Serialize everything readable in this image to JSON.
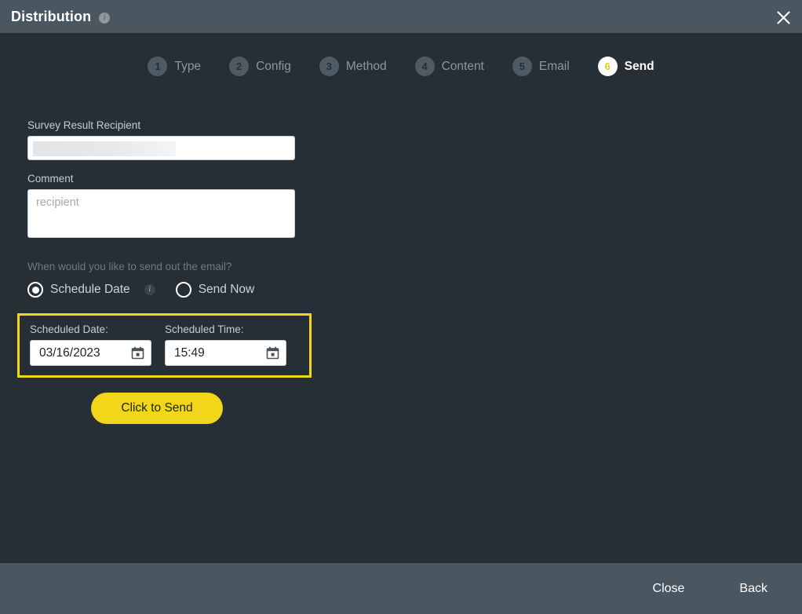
{
  "window": {
    "title": "Distribution",
    "title_info_icon": "info-icon",
    "close_icon": "close-icon"
  },
  "steps": [
    {
      "number": "1",
      "label": "Type",
      "active": false
    },
    {
      "number": "2",
      "label": "Config",
      "active": false
    },
    {
      "number": "3",
      "label": "Method",
      "active": false
    },
    {
      "number": "4",
      "label": "Content",
      "active": false
    },
    {
      "number": "5",
      "label": "Email",
      "active": false
    },
    {
      "number": "6",
      "label": "Send",
      "active": true
    }
  ],
  "form": {
    "recipient": {
      "label": "Survey Result Recipient",
      "value": "",
      "redacted": true
    },
    "comment": {
      "label": "Comment",
      "placeholder": "recipient",
      "value": ""
    },
    "when_question": "When would you like to send out the email?",
    "radios": [
      {
        "label": "Schedule Date",
        "selected": true,
        "info_icon": "info-icon"
      },
      {
        "label": "Send Now",
        "selected": false,
        "info_icon": null
      }
    ],
    "schedule": {
      "date_label": "Scheduled Date:",
      "date_value": "03/16/2023",
      "time_label": "Scheduled Time:",
      "time_value": "15:49",
      "date_picker_icon": "calendar-icon",
      "time_picker_icon": "calendar-icon",
      "highlight_color": "#f2d61a"
    },
    "send_button": "Click to Send"
  },
  "footer": {
    "close_label": "Close",
    "back_label": "Back"
  },
  "colors": {
    "accent": "#f2d61a",
    "titlebar_bg": "#4a5660",
    "body_bg": "#262f36",
    "step_inactive": "#4f5b64",
    "muted_text": "#8d969d"
  }
}
